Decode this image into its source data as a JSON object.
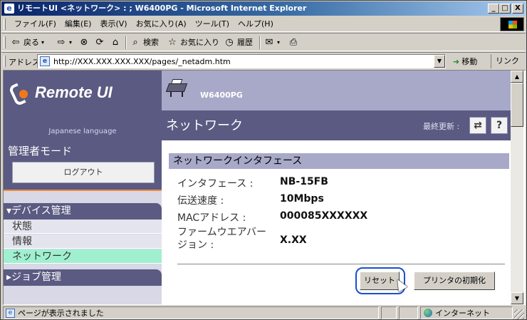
{
  "window": {
    "title": "リモートUI <ネットワーク> : ; W6400PG - Microsoft Internet Explorer",
    "minimize": "_",
    "maximize": "□",
    "close": "X"
  },
  "menu": [
    "ファイル(F)",
    "編集(E)",
    "表示(V)",
    "お気に入り(A)",
    "ツール(T)",
    "ヘルプ(H)"
  ],
  "toolbar": {
    "back": "戻る",
    "search": "検索",
    "favorites": "お気に入り",
    "history": "履歴"
  },
  "address": {
    "label": "アドレス(D)",
    "url": "http://XXX.XXX.XXX.XXX/pages/_netadm.htm",
    "go": "移動",
    "links": "リンク »"
  },
  "nav": {
    "logo": "Remote UI",
    "language": "Japanese language",
    "mode": "管理者モード",
    "logout": "ログアウト",
    "device_header": "▾デバイス管理",
    "items": [
      "状態",
      "情報",
      "ネットワーク"
    ],
    "job_header": "▸ジョブ管理"
  },
  "main": {
    "model": "W6400PG",
    "page_title": "ネットワーク",
    "last_update": "最終更新 :",
    "refresh_icon": "refresh-icon",
    "help_label": "?",
    "section_title": "ネットワークインタフェース",
    "rows": [
      {
        "label": "インタフェース :",
        "value": "NB-15FB"
      },
      {
        "label": "伝送速度 :",
        "value": "10Mbps"
      },
      {
        "label": "MACアドレス :",
        "value": "000085XXXXXX"
      },
      {
        "label": "ファームウエアバージョン :",
        "value": "X.XX"
      }
    ],
    "reset_button": "リセット",
    "init_button": "プリンタの初期化"
  },
  "status": {
    "message": "ページが表示されました",
    "zone": "インターネット"
  },
  "colors": {
    "nav_bg": "#5a5a82",
    "header_bg": "#a8a8c8",
    "active_nav": "#a0f0d0",
    "accent": "#f08a3a",
    "highlight": "#1a4fd0"
  }
}
